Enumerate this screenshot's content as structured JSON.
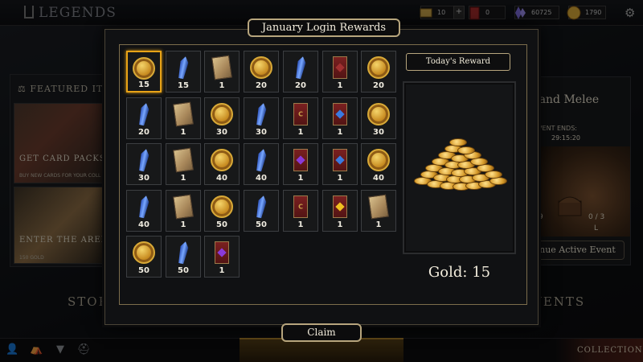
{
  "app": {
    "title": "LEGENDS"
  },
  "resources": [
    {
      "name": "tickets",
      "value": "10",
      "icon": "ticket-icon"
    },
    {
      "name": "packs",
      "value": "0",
      "icon": "pack-icon"
    },
    {
      "name": "crystals",
      "value": "60725",
      "icon": "crystal-icon"
    },
    {
      "name": "gold",
      "value": "1790",
      "icon": "gold-coin-icon"
    }
  ],
  "resource_plus": "+",
  "background": {
    "featured_header": "FEATURED ITE",
    "card_packs_title": "GET CARD PACKS",
    "card_packs_sub": "BUY NEW CARDS FOR YOUR COLL",
    "arena_title": "ENTER THE ARENA",
    "arena_sub": "150 GOLD",
    "store": "STOR",
    "event_title": "rand Melee",
    "event_ends_label": "EVENT ENDS:",
    "event_timer": "29:15:20",
    "event_left": "9",
    "event_progress": "0 / 3",
    "event_l": "L",
    "event_button": "tinue Active Event",
    "events": "VENTS",
    "collection": "COLLECTION"
  },
  "modal": {
    "title": "January Login Rewards",
    "today_label": "Today's Reward",
    "reward_text": "Gold: 15",
    "claim_label": "Claim",
    "rewards": [
      {
        "type": "gold",
        "count": "15",
        "selected": true
      },
      {
        "type": "crystal",
        "count": "15"
      },
      {
        "type": "scroll",
        "count": "1"
      },
      {
        "type": "gold",
        "count": "20"
      },
      {
        "type": "crystal",
        "count": "20"
      },
      {
        "type": "card-red",
        "count": "1"
      },
      {
        "type": "gold",
        "count": "20"
      },
      {
        "type": "crystal",
        "count": "20"
      },
      {
        "type": "scroll",
        "count": "1"
      },
      {
        "type": "gold",
        "count": "30"
      },
      {
        "type": "crystal",
        "count": "30"
      },
      {
        "type": "card-c",
        "count": "1"
      },
      {
        "type": "card-blue",
        "count": "1"
      },
      {
        "type": "gold",
        "count": "30"
      },
      {
        "type": "crystal",
        "count": "30"
      },
      {
        "type": "scroll",
        "count": "1"
      },
      {
        "type": "gold",
        "count": "40"
      },
      {
        "type": "crystal",
        "count": "40"
      },
      {
        "type": "card-purple",
        "count": "1"
      },
      {
        "type": "card-blue",
        "count": "1"
      },
      {
        "type": "gold",
        "count": "40"
      },
      {
        "type": "crystal",
        "count": "40"
      },
      {
        "type": "scroll",
        "count": "1"
      },
      {
        "type": "gold",
        "count": "50"
      },
      {
        "type": "crystal",
        "count": "50"
      },
      {
        "type": "card-c",
        "count": "1"
      },
      {
        "type": "card-yellow",
        "count": "1"
      },
      {
        "type": "scroll",
        "count": "1"
      },
      {
        "type": "gold",
        "count": "50"
      },
      {
        "type": "crystal",
        "count": "50"
      },
      {
        "type": "card-purple",
        "count": "1"
      }
    ]
  },
  "colors": {
    "accent": "#b7a57d",
    "selected": "#e8a317",
    "background": "#0c0d10"
  }
}
